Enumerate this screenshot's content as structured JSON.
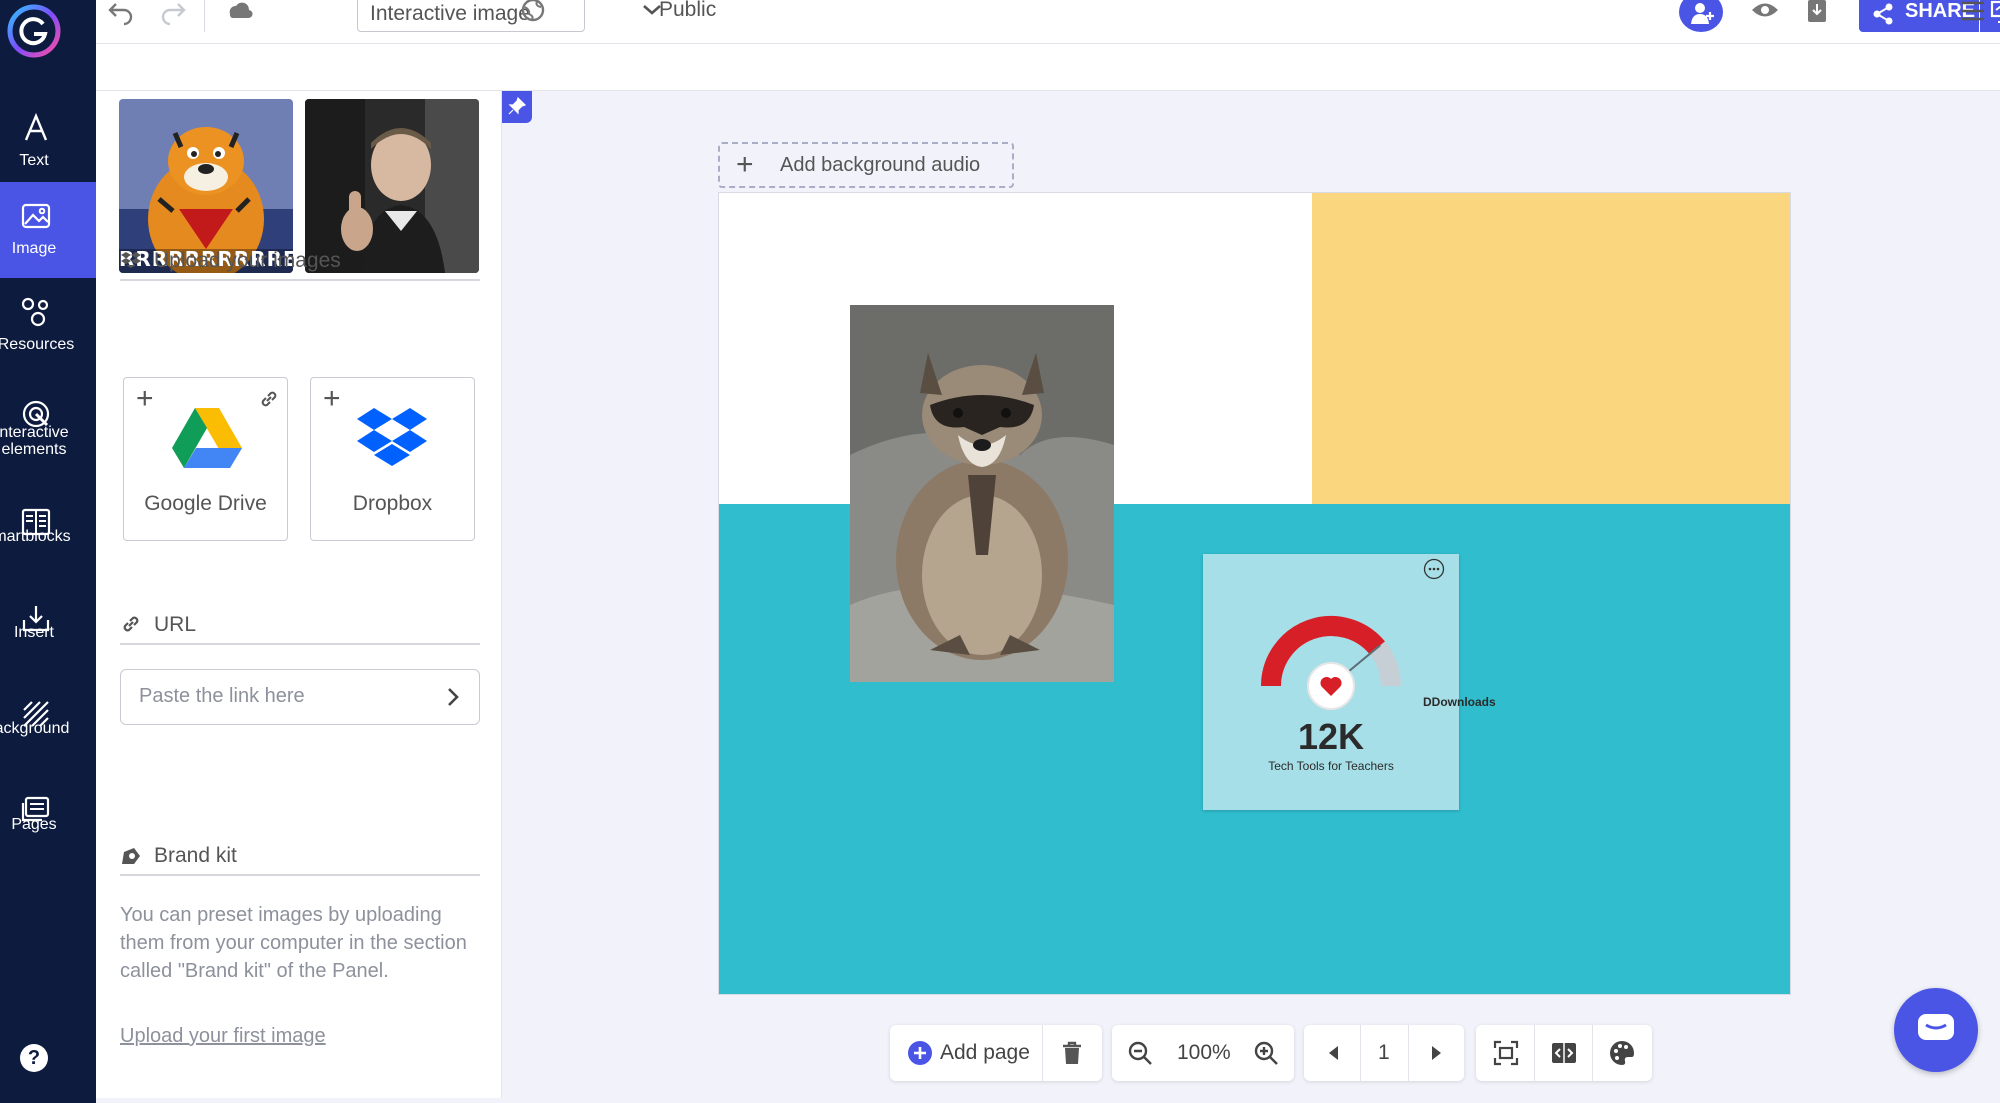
{
  "rail": {
    "items": [
      {
        "label": "Text",
        "icon": "text-icon"
      },
      {
        "label": "Image",
        "icon": "image-icon"
      },
      {
        "label": "Resources",
        "icon": "resources-icon"
      },
      {
        "label": "nteractive\nelements",
        "icon": "interactive-icon"
      },
      {
        "label": "martblocks",
        "icon": "smartblocks-icon"
      },
      {
        "label": "Insert",
        "icon": "insert-icon"
      },
      {
        "label": "ackground",
        "icon": "background-icon"
      },
      {
        "label": "Pages",
        "icon": "pages-icon"
      }
    ],
    "help": "?"
  },
  "topbar": {
    "title_value": "Interactive image",
    "visibility": "Public",
    "share_label": "SHARE"
  },
  "panel": {
    "gif_caption": "RRRRRRRRRREA",
    "upload_heading": "Upload your images",
    "google_drive": "Google Drive",
    "dropbox": "Dropbox",
    "url_heading": "URL",
    "url_placeholder": "Paste the link here",
    "brand_heading": "Brand kit",
    "brand_text": "You can preset images by uploading them from your computer in the section called \"Brand kit\" of the Panel.",
    "upload_link": "Upload your first image"
  },
  "canvas": {
    "bg_audio": "Add background audio",
    "widget": {
      "count": "12K",
      "subtitle": "Tech Tools for Teachers",
      "downloads": "DDownloads",
      "gauge_level": 0.78
    }
  },
  "bottom": {
    "add_page": "Add page",
    "zoom": "100%",
    "page_number": "1"
  },
  "colors": {
    "accent": "#4a55e6",
    "rail": "#0d1b3e",
    "yellow": "#fad77f",
    "teal": "#30bdcd",
    "widget": "#a6dfe7",
    "gauge_red": "#d61f26"
  }
}
